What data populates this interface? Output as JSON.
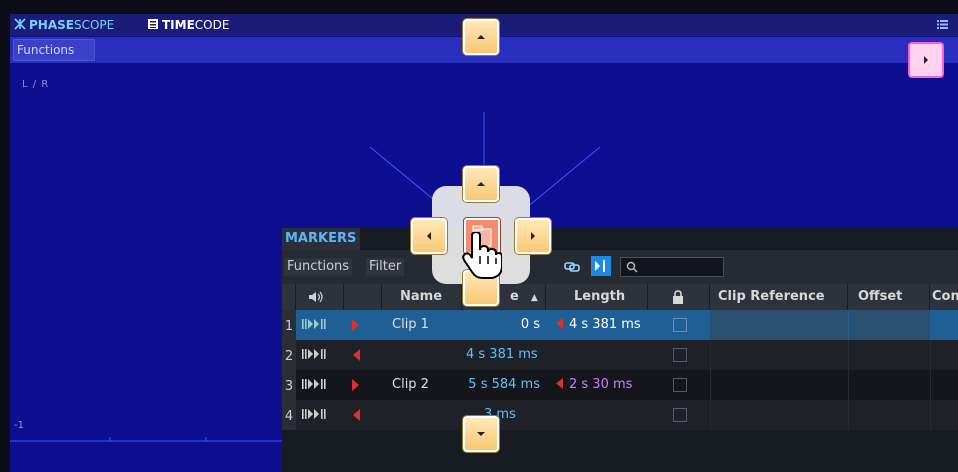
{
  "tabs": [
    {
      "bold": "PHASE",
      "rest": "SCOPE",
      "active": true,
      "icon": "phasescope-icon"
    },
    {
      "bold": "TIME",
      "rest": "CODE",
      "active": false,
      "icon": "timecode-icon"
    }
  ],
  "scope": {
    "functions_label": "Functions",
    "channel_label": "L / R",
    "y_min_label": "-1"
  },
  "markers": {
    "panel_title": "MARKERS",
    "toolbar": {
      "functions_label": "Functions",
      "filter_label": "Filter",
      "search_value": ""
    },
    "columns": [
      "",
      "Name",
      "e",
      "Length",
      "",
      "Clip Reference",
      "Offset",
      "Con"
    ],
    "rows": [
      {
        "num": "1",
        "name": "Clip 1",
        "time": "0 s",
        "length": "4 s 381 ms",
        "flag": "start",
        "selected": true
      },
      {
        "num": "2",
        "name": "",
        "time": "4 s 381 ms",
        "length": "",
        "flag": "end",
        "selected": false
      },
      {
        "num": "3",
        "name": "Clip 2",
        "time": "5 s 584 ms",
        "length": "2 s 30 ms",
        "flag": "start",
        "selected": false
      },
      {
        "num": "4",
        "name": "",
        "time": "3 ms",
        "length": "",
        "flag": "end",
        "selected": false
      }
    ]
  },
  "colors": {
    "scope_bg": "#0e0e90",
    "active_tab": "#7ad0ff",
    "selection": "#1f5f96",
    "time_text": "#57c3ff",
    "length_text": "#d27cff",
    "flag_red": "#e0302a",
    "dock_button": "#f8c774",
    "dock_pink": "#ff5fc8"
  }
}
